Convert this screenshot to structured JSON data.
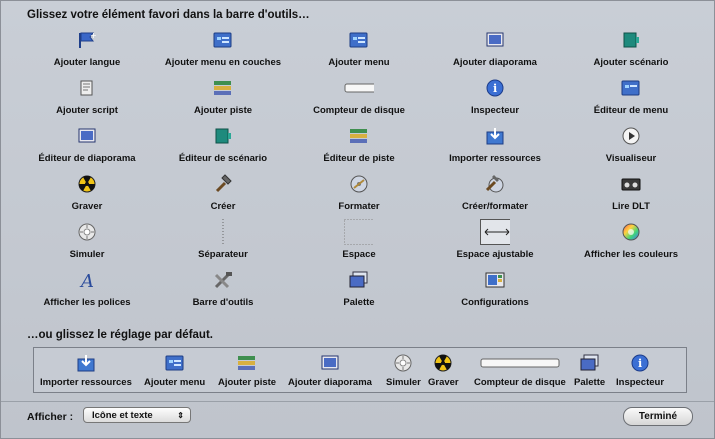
{
  "headings": {
    "drag_items": "Glissez votre élément favori dans la barre d'outils…",
    "drag_default": "…ou glissez le réglage par défaut."
  },
  "items": [
    {
      "label": "Ajouter langue",
      "icon": "flag-icon"
    },
    {
      "label": "Ajouter menu en couches",
      "icon": "layered-menu-icon"
    },
    {
      "label": "Ajouter menu",
      "icon": "menu-icon"
    },
    {
      "label": "Ajouter diaporama",
      "icon": "slideshow-icon"
    },
    {
      "label": "Ajouter scénario",
      "icon": "story-icon"
    },
    {
      "label": "Ajouter script",
      "icon": "script-icon"
    },
    {
      "label": "Ajouter piste",
      "icon": "track-icon"
    },
    {
      "label": "Compteur de disque",
      "icon": "disc-meter-icon"
    },
    {
      "label": "Inspecteur",
      "icon": "info-icon"
    },
    {
      "label": "Éditeur de menu",
      "icon": "menu-editor-icon"
    },
    {
      "label": "Éditeur de diaporama",
      "icon": "slideshow-editor-icon"
    },
    {
      "label": "Éditeur de scénario",
      "icon": "story-editor-icon"
    },
    {
      "label": "Éditeur de piste",
      "icon": "track-editor-icon"
    },
    {
      "label": "Importer ressources",
      "icon": "import-icon"
    },
    {
      "label": "Visualiseur",
      "icon": "play-icon"
    },
    {
      "label": "Graver",
      "icon": "burn-icon"
    },
    {
      "label": "Créer",
      "icon": "hammer-icon"
    },
    {
      "label": "Formater",
      "icon": "format-icon"
    },
    {
      "label": "Créer/formater",
      "icon": "build-format-icon"
    },
    {
      "label": "Lire DLT",
      "icon": "dlt-tape-icon"
    },
    {
      "label": "Simuler",
      "icon": "simulator-icon"
    },
    {
      "label": "Séparateur",
      "icon": "separator-icon"
    },
    {
      "label": "Espace",
      "icon": "space-icon"
    },
    {
      "label": "Espace ajustable",
      "icon": "flexible-space-icon"
    },
    {
      "label": "Afficher les couleurs",
      "icon": "color-wheel-icon"
    },
    {
      "label": "Afficher les polices",
      "icon": "fonts-icon"
    },
    {
      "label": "Barre d'outils",
      "icon": "toolbar-tools-icon"
    },
    {
      "label": "Palette",
      "icon": "palette-icon"
    },
    {
      "label": "Configurations",
      "icon": "configurations-icon"
    }
  ],
  "default_set": [
    {
      "label": "Importer ressources",
      "icon": "import-icon"
    },
    {
      "label": "Ajouter menu",
      "icon": "menu-icon"
    },
    {
      "label": "Ajouter piste",
      "icon": "track-icon"
    },
    {
      "label": "Ajouter diaporama",
      "icon": "slideshow-icon"
    },
    {
      "label": "Simuler",
      "icon": "simulator-icon"
    },
    {
      "label": "Graver",
      "icon": "burn-icon"
    },
    {
      "label": "Compteur de disque",
      "icon": "disc-meter-icon"
    },
    {
      "label": "Palette",
      "icon": "palette-icon"
    },
    {
      "label": "Inspecteur",
      "icon": "info-icon"
    }
  ],
  "footer": {
    "show_label": "Afficher :",
    "show_value": "Icône et texte",
    "done_label": "Terminé"
  }
}
